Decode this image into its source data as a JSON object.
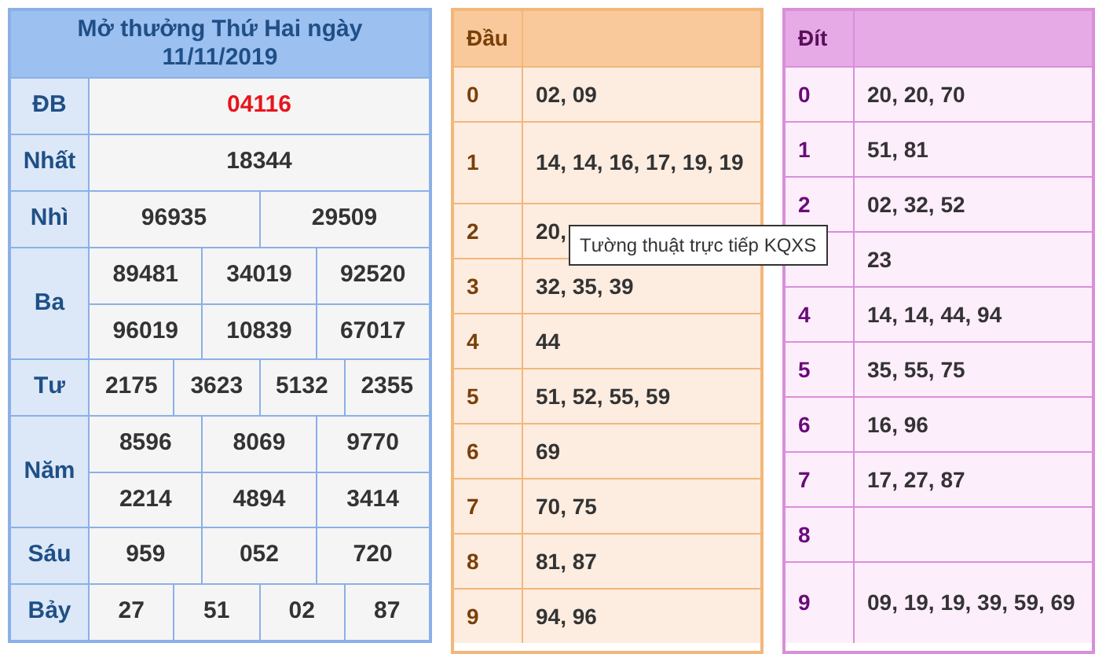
{
  "results": {
    "title": "Mở thưởng Thứ Hai ngày",
    "date": "11/11/2019",
    "prizes": [
      {
        "label": "ĐB",
        "highlight": true,
        "lines": [
          [
            "04116"
          ]
        ]
      },
      {
        "label": "Nhất",
        "highlight": false,
        "lines": [
          [
            "18344"
          ]
        ]
      },
      {
        "label": "Nhì",
        "highlight": false,
        "lines": [
          [
            "96935",
            "29509"
          ]
        ]
      },
      {
        "label": "Ba",
        "highlight": false,
        "lines": [
          [
            "89481",
            "34019",
            "92520"
          ],
          [
            "96019",
            "10839",
            "67017"
          ]
        ]
      },
      {
        "label": "Tư",
        "highlight": false,
        "lines": [
          [
            "2175",
            "3623",
            "5132",
            "2355"
          ]
        ]
      },
      {
        "label": "Năm",
        "highlight": false,
        "lines": [
          [
            "8596",
            "8069",
            "9770"
          ],
          [
            "2214",
            "4894",
            "3414"
          ]
        ]
      },
      {
        "label": "Sáu",
        "highlight": false,
        "lines": [
          [
            "959",
            "052",
            "720"
          ]
        ]
      },
      {
        "label": "Bảy",
        "highlight": false,
        "lines": [
          [
            "27",
            "51",
            "02",
            "87"
          ]
        ]
      }
    ]
  },
  "heads": {
    "title": "Đầu",
    "rows": [
      {
        "digit": "0",
        "values": "02, 09"
      },
      {
        "digit": "1",
        "values": "14, 14, 16, 17, 19, 19"
      },
      {
        "digit": "2",
        "values": "20,"
      },
      {
        "digit": "3",
        "values": "32, 35, 39"
      },
      {
        "digit": "4",
        "values": "44"
      },
      {
        "digit": "5",
        "values": "51, 52, 55, 59"
      },
      {
        "digit": "6",
        "values": "69"
      },
      {
        "digit": "7",
        "values": "70, 75"
      },
      {
        "digit": "8",
        "values": "81, 87"
      },
      {
        "digit": "9",
        "values": "94, 96"
      }
    ]
  },
  "tails": {
    "title": "Đít",
    "rows": [
      {
        "digit": "0",
        "values": "20, 20, 70"
      },
      {
        "digit": "1",
        "values": "51, 81"
      },
      {
        "digit": "2",
        "values": "02, 32, 52"
      },
      {
        "values": "23"
      },
      {
        "digit": "4",
        "values": "14, 14, 44, 94"
      },
      {
        "digit": "5",
        "values": "35, 55, 75"
      },
      {
        "digit": "6",
        "values": "16, 96"
      },
      {
        "digit": "7",
        "values": "17, 27, 87"
      },
      {
        "digit": "8"
      },
      {
        "digit": "9",
        "values": "09, 19, 19, 39, 59, 69"
      }
    ]
  },
  "tooltip": {
    "text": "Tường thuật trực tiếp KQXS"
  }
}
